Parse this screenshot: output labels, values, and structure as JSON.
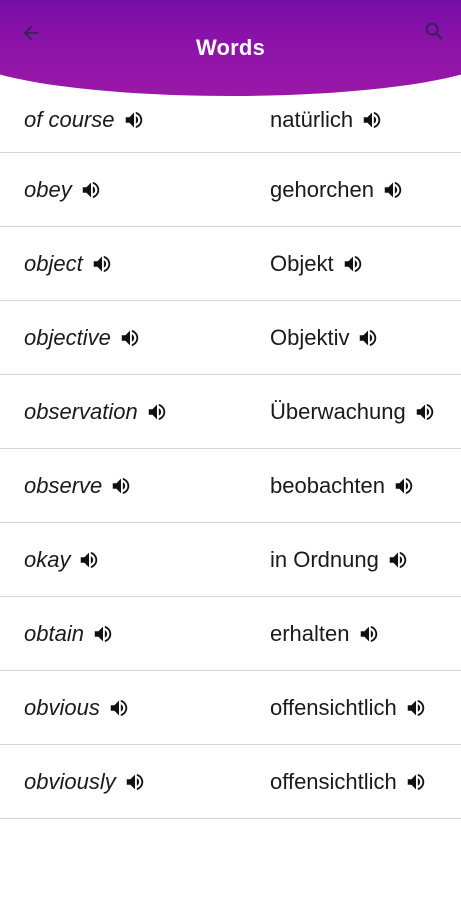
{
  "header": {
    "title": "Words",
    "back_icon": "arrow-left-icon",
    "search_icon": "search-icon",
    "gradient_start": "#5b0aa3",
    "gradient_end": "#9a18a8"
  },
  "speaker_icon": "speaker-icon",
  "words": [
    {
      "en": "of course",
      "de": "natürlich"
    },
    {
      "en": "obey",
      "de": "gehorchen"
    },
    {
      "en": "object",
      "de": "Objekt"
    },
    {
      "en": "objective",
      "de": "Objektiv"
    },
    {
      "en": "observation",
      "de": "Überwachung"
    },
    {
      "en": "observe",
      "de": "beobachten"
    },
    {
      "en": "okay",
      "de": "in Ordnung"
    },
    {
      "en": "obtain",
      "de": "erhalten"
    },
    {
      "en": "obvious",
      "de": "offensichtlich"
    },
    {
      "en": "obviously",
      "de": "offensichtlich"
    }
  ]
}
